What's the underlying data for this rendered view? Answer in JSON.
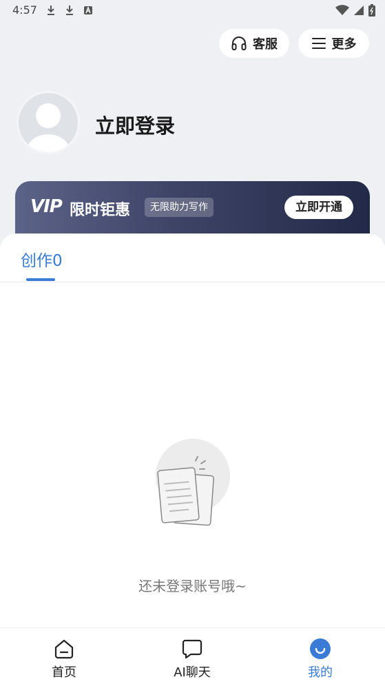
{
  "status_bar": {
    "time": "4:57",
    "icons_left": [
      "download-icon",
      "download-icon",
      "font-a-icon"
    ],
    "icons_right": [
      "wifi-icon",
      "signal-icon",
      "battery-icon"
    ]
  },
  "header": {
    "service_label": "客服",
    "more_label": "更多"
  },
  "profile": {
    "login_title": "立即登录"
  },
  "vip_banner": {
    "logo": "VIP",
    "title": "限时钜惠",
    "tag": "无限助力写作",
    "button": "立即开通"
  },
  "tabs": {
    "creation_label": "创作0"
  },
  "empty_state": {
    "message": "还未登录账号哦~"
  },
  "bottom_nav": {
    "items": [
      {
        "label": "首页",
        "icon": "home-icon"
      },
      {
        "label": "AI聊天",
        "icon": "chat-bubble-icon"
      },
      {
        "label": "我的",
        "icon": "profile-smile-icon"
      }
    ]
  },
  "colors": {
    "accent": "#3a7bd5",
    "background": "#eef0f3",
    "vip_gradient_start": "#5c6388",
    "vip_gradient_end": "#232a48"
  }
}
